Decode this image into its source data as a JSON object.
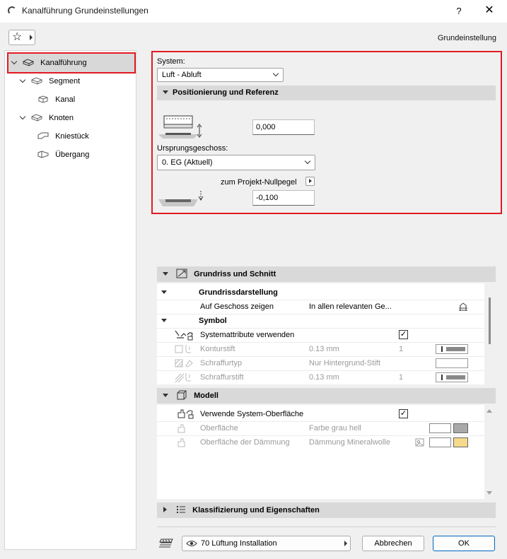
{
  "window": {
    "title": "Kanalführung Grundeinstellungen",
    "help": "?",
    "close": "✕"
  },
  "toolbar": {
    "preset_label": "Grundeinstellung"
  },
  "tree": {
    "items": [
      {
        "label": "Kanalführung"
      },
      {
        "label": "Segment"
      },
      {
        "label": "Kanal"
      },
      {
        "label": "Knoten"
      },
      {
        "label": "Kniestück"
      },
      {
        "label": "Übergang"
      }
    ]
  },
  "system": {
    "label": "System:",
    "value": "Luft - Abluft"
  },
  "positioning": {
    "header": "Positionierung und Referenz",
    "offset_value": "0,000",
    "origin_label": "Ursprungsgeschoss:",
    "origin_value": "0. EG (Aktuell)",
    "zero_label": "zum Projekt-Nullpegel",
    "zero_value": "-0,100"
  },
  "floorplan": {
    "header": "Grundriss und Schnitt",
    "group1": "Grundrissdarstellung",
    "show_on_story_label": "Auf Geschoss zeigen",
    "show_on_story_value": "In allen relevanten Ge...",
    "group2": "Symbol",
    "sys_attr_label": "Systemattribute verwenden",
    "rows": [
      {
        "label": "Konturstift",
        "value": "0.13 mm",
        "num": "1"
      },
      {
        "label": "Schraffurtyp",
        "value": "Nur Hintergrund-Stift",
        "num": ""
      },
      {
        "label": "Schraffurstift",
        "value": "0.13 mm",
        "num": "1"
      }
    ]
  },
  "model": {
    "header": "Modell",
    "sys_surface_label": "Verwende System-Oberfläche",
    "rows": [
      {
        "label": "Oberfläche",
        "value": "Farbe grau hell"
      },
      {
        "label": "Oberfläche der Dämmung",
        "value": "Dämmung Mineralwolle"
      }
    ]
  },
  "classification": {
    "header": "Klassifizierung und Eigenschaften"
  },
  "footer": {
    "layer": "70 Lüftung Installation",
    "cancel": "Abbrechen",
    "ok": "OK"
  },
  "colors": {
    "highlight": "#e21a22",
    "swatch_grey": "#a8a8a8",
    "swatch_insul": "#f5d98c"
  }
}
